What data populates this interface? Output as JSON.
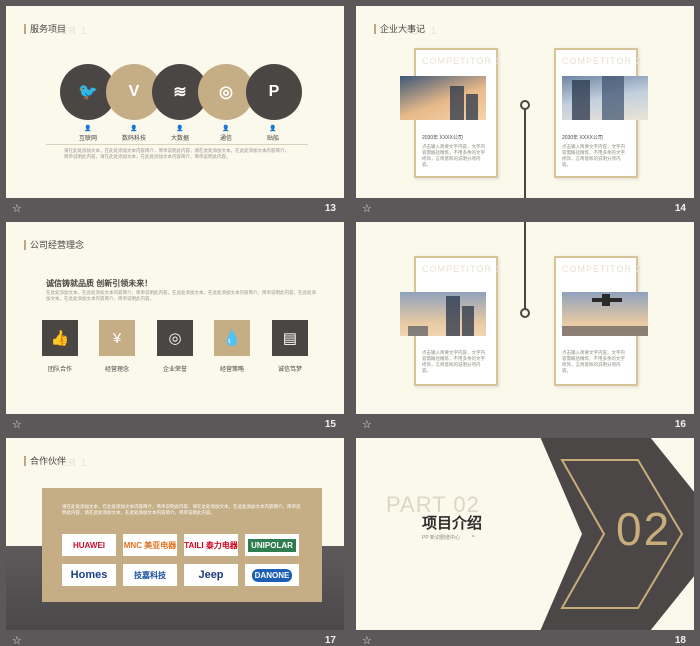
{
  "slides": [
    {
      "number": "13",
      "title": "服务项目",
      "ghost": "TER 1",
      "circles": [
        {
          "icon": "twitter-icon",
          "glyph": "🐦",
          "label": "互联网"
        },
        {
          "icon": "vine-icon",
          "glyph": "V",
          "label": "数码科技"
        },
        {
          "icon": "spotify-icon",
          "glyph": "≋",
          "label": "大数据"
        },
        {
          "icon": "instagram-icon",
          "glyph": "◎",
          "label": "通信"
        },
        {
          "icon": "pinterest-icon",
          "glyph": "P",
          "label": "贴船"
        }
      ],
      "body": "请在此处添加文本，在此处添加文本内容简介，简单说明此内容，请在此处添加文本，在此处添加文本内容简介，简单说明此内容，请在此处添加文本，在此处添加文本内容简介，简单说明此内容。"
    },
    {
      "number": "14",
      "title": "企业大事记",
      "ghost": "TER 1",
      "cards": [
        {
          "ghost": "COMPETITOR 1",
          "title": "2030年 XXXX公司",
          "text": "点击输入简要文字内容，文字内容需概括精炼，不用多余的文字修饰，言简意赅的说明分项内容。"
        },
        {
          "ghost": "COMPETITOR 2",
          "title": "2030年 XXXX公司",
          "text": "点击输入简要文字内容，文字内容需概括精炼，不用多余的文字修饰，言简意赅的说明分项内容。"
        }
      ]
    },
    {
      "number": "15",
      "title": "公司经营理念",
      "headline": "诚信铸就品质   创新引领未来！",
      "body": "在此处添加文本，在此处添加文本内容简介，简单说明此内容，在此处添加文本，在此处添加文本内容简介，简单说明此内容，在此处添加文本，在此处添加文本内容简介，简单说明此内容。",
      "items": [
        {
          "icon": "thumbs-up-icon",
          "glyph": "👍",
          "label": "团队合作"
        },
        {
          "icon": "yen-coin-icon",
          "glyph": "¥",
          "label": "经营理念"
        },
        {
          "icon": "target-icon",
          "glyph": "◎",
          "label": "企业荣誉"
        },
        {
          "icon": "drop-icon",
          "glyph": "💧",
          "label": "经营策略"
        },
        {
          "icon": "document-icon",
          "glyph": "▤",
          "label": "诚信笃梦"
        }
      ]
    },
    {
      "number": "16",
      "cards": [
        {
          "ghost": "COMPETITOR 1",
          "text": "点击输入简要文字内容，文字内容需概括精炼，不用多余的文字修饰，言简意赅的说明分项内容。"
        },
        {
          "ghost": "COMPETITOR 2",
          "text": "点击输入简要文字内容，文字内容需概括精炼，不用多余的文字修饰，言简意赅的说明分项内容。"
        }
      ]
    },
    {
      "number": "17",
      "title": "合作伙伴",
      "ghost": "TER 1",
      "body": "请在此处添加文本，在此处添加文本内容简介，简单说明此内容，请在此处添加文本，在此处添加文本内容简介，简单说明此内容，请在此处添加文本，在此处添加文本内容简介，简单说明此内容。",
      "logos": [
        {
          "name": "HUAWEI",
          "color": "#c8102e"
        },
        {
          "name": "MNC 美亚电器",
          "color": "#e2711d"
        },
        {
          "name": "TAILI 泰力电器",
          "color": "#d0021b"
        },
        {
          "name": "UNIPOLAR",
          "color": "#2e7d4f"
        },
        {
          "name": "Homes",
          "color": "#1b3f8f"
        },
        {
          "name": "技嘉科技",
          "color": "#1a4fa0"
        },
        {
          "name": "Jeep",
          "color": "#1f3b7a"
        },
        {
          "name": "DANONE",
          "color": "#1d5fb4"
        }
      ]
    },
    {
      "number": "18",
      "part": "PART 02",
      "title": "项目介绍",
      "subtitle": "PP 新识剧增中心",
      "quote": "“",
      "big": "02"
    }
  ]
}
